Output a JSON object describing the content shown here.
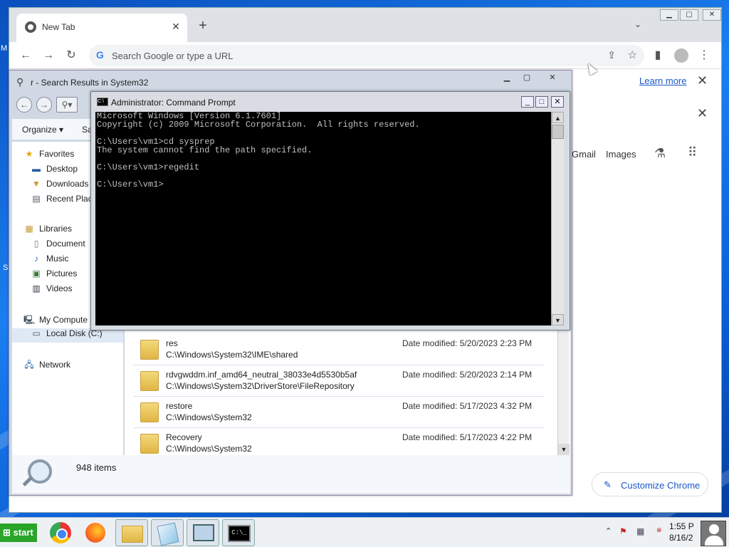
{
  "desktop": {
    "edge_letter_1": "M",
    "edge_letter_2": "S"
  },
  "chrome": {
    "tab_title": "New Tab",
    "tab_close": "✕",
    "new_tab": "+",
    "tab_search": "⌄",
    "omnibox_placeholder": "Search Google or type a URL",
    "learn_more": "Learn more",
    "close_glyph": "✕",
    "gmail": "Gmail",
    "images": "Images",
    "customize": "Customize Chrome"
  },
  "explorer": {
    "title": "r - Search Results in System32",
    "organize": "Organize ▾",
    "sa": "Sa",
    "nav": {
      "favorites": "Favorites",
      "desktop": "Desktop",
      "downloads": "Downloads",
      "recent": "Recent Plac",
      "libraries": "Libraries",
      "documents": "Document",
      "music": "Music",
      "pictures": "Pictures",
      "videos": "Videos",
      "computer": "My Compute",
      "local_disk": "Local Disk (C:)",
      "network": "Network"
    },
    "rows": [
      {
        "name": "res",
        "path": "C:\\Windows\\System32\\IME\\shared",
        "date": "Date modified: 5/20/2023 2:23 PM"
      },
      {
        "name": "rdvgwddm.inf_amd64_neutral_38033e4d5530b5af",
        "path": "C:\\Windows\\System32\\DriverStore\\FileRepository",
        "date": "Date modified: 5/20/2023 2:14 PM"
      },
      {
        "name": "restore",
        "path": "C:\\Windows\\System32",
        "date": "Date modified: 5/17/2023 4:32 PM"
      },
      {
        "name": "Recovery",
        "path": "C:\\Windows\\System32",
        "date": "Date modified: 5/17/2023 4:22 PM"
      }
    ],
    "item_count": "948 items"
  },
  "cmd": {
    "title": "Administrator: Command Prompt",
    "lines": [
      "Microsoft Windows [Version 6.1.7601]",
      "Copyright (c) 2009 Microsoft Corporation.  All rights reserved.",
      "",
      "C:\\Users\\vm1>cd sysprep",
      "The system cannot find the path specified.",
      "",
      "C:\\Users\\vm1>regedit",
      "",
      "C:\\Users\\vm1>"
    ]
  },
  "taskbar": {
    "start": "start",
    "cmd_glyph": "C:\\_",
    "time": "1:55 P",
    "date": "8/16/2"
  }
}
